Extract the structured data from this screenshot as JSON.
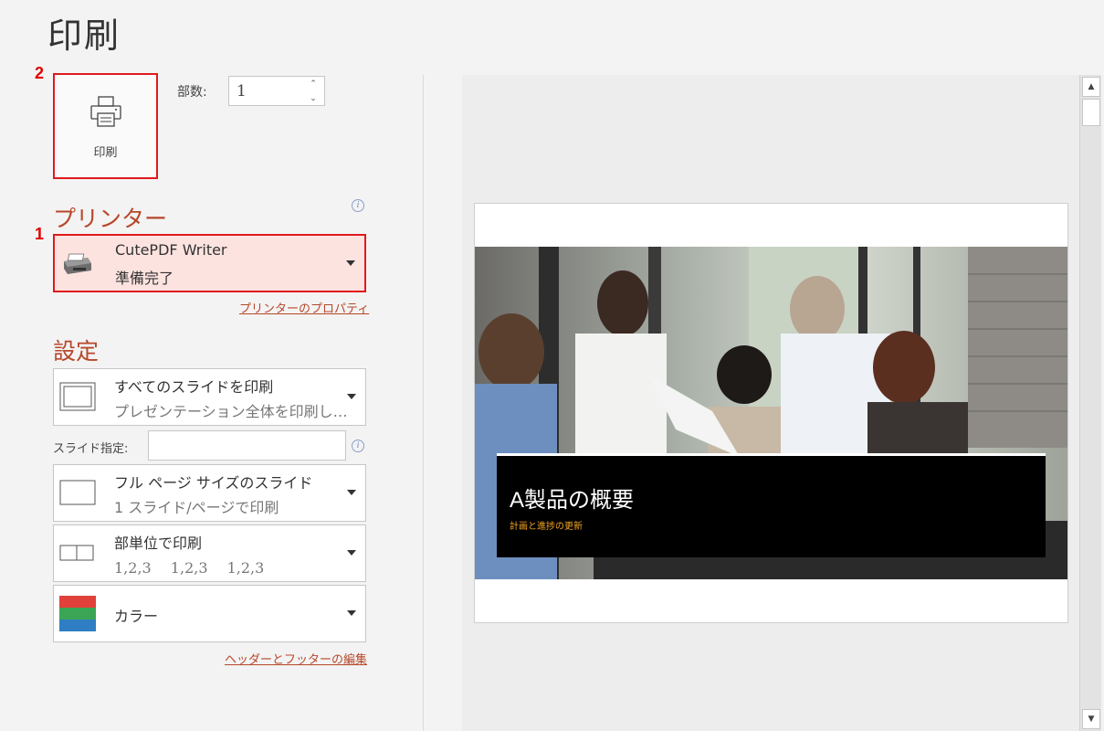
{
  "page": {
    "title": "印刷"
  },
  "annotations": {
    "step1": "1",
    "step2": "2"
  },
  "print_button": {
    "label": "印刷",
    "icon": "printer-icon"
  },
  "copies": {
    "label": "部数:",
    "value": "1"
  },
  "printer": {
    "section_title": "プリンター",
    "name": "CutePDF Writer",
    "status": "準備完了",
    "properties_link": "プリンターのプロパティ",
    "icon": "printer-device-icon"
  },
  "settings": {
    "section_title": "設定",
    "range": {
      "title": "すべてのスライドを印刷",
      "subtitle": "プレゼンテーション全体を印刷し…"
    },
    "slides_label": "スライド指定:",
    "slides_value": "",
    "layout": {
      "title": "フル ページ サイズのスライド",
      "subtitle": "1 スライド/ページで印刷"
    },
    "collate": {
      "title": "部単位で印刷",
      "subtitle": "1,2,3　 1,2,3　 1,2,3"
    },
    "color": {
      "title": "カラー"
    },
    "header_footer_link": "ヘッダーとフッターの編集"
  },
  "preview": {
    "slide_title": "A製品の概要",
    "slide_subtitle": "計画と進捗の更新"
  },
  "colors": {
    "accent": "#b7472a",
    "highlight_border": "#e0191d",
    "highlight_fill": "#fde3e0"
  }
}
